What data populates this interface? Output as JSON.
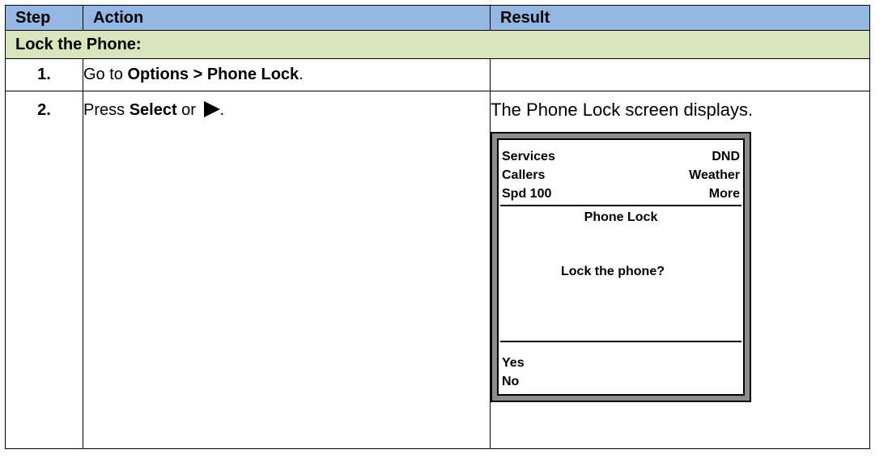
{
  "table": {
    "headers": [
      "Step",
      "Action",
      "Result"
    ],
    "section_title": "Lock the Phone:",
    "rows": [
      {
        "step": "1.",
        "action_prefix": "Go to ",
        "action_bold": "Options > Phone Lock",
        "action_suffix": ".",
        "result": ""
      },
      {
        "step": "2.",
        "action_prefix": "Press ",
        "action_bold": "Select",
        "action_mid": " or ",
        "action_suffix": ".",
        "result": "The Phone Lock screen displays."
      }
    ]
  },
  "phone_screen": {
    "top_rows": [
      {
        "left": "Services",
        "right": "DND"
      },
      {
        "left": "Callers",
        "right": "Weather"
      },
      {
        "left": "Spd 100",
        "right": "More"
      }
    ],
    "title": "Phone Lock",
    "prompt": "Lock the phone?",
    "options": [
      "Yes",
      "No"
    ]
  }
}
